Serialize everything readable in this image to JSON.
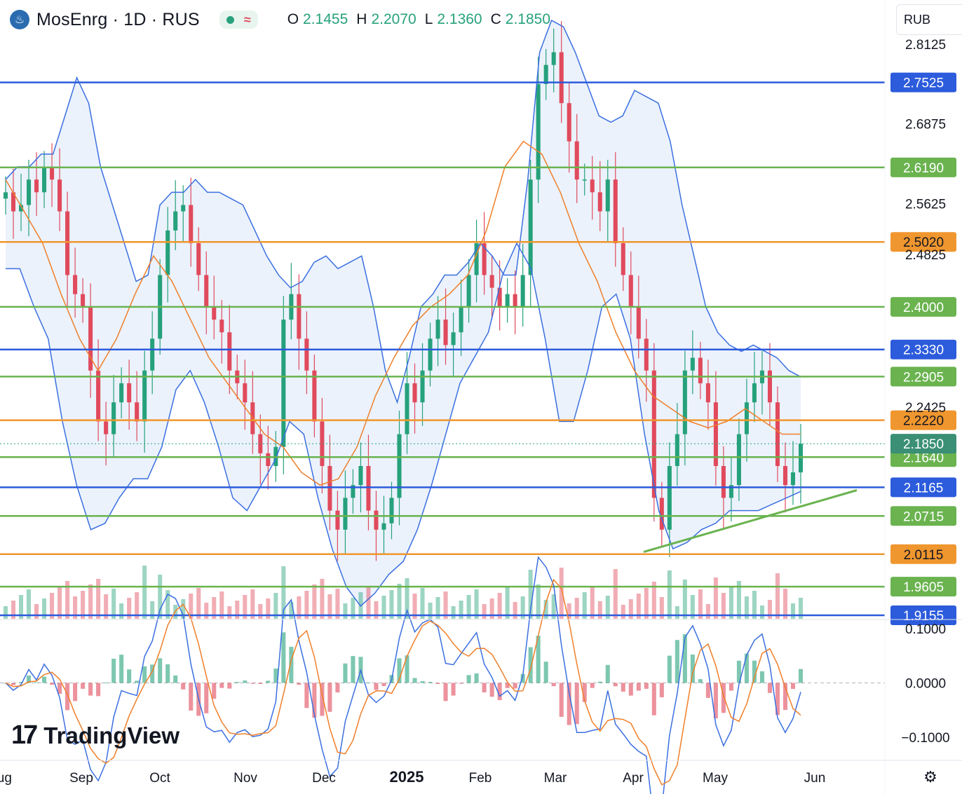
{
  "header": {
    "symbol_title": "MosEnrg · 1D · RUS",
    "logo_icon": "gazprom-flame-icon",
    "ohlc": [
      {
        "label": "O",
        "value": "2.1455"
      },
      {
        "label": "H",
        "value": "2.2070"
      },
      {
        "label": "L",
        "value": "2.1360"
      },
      {
        "label": "C",
        "value": "2.1850"
      }
    ]
  },
  "currency": {
    "label": "RUB"
  },
  "watermark": {
    "text": "TradingView",
    "mark": "17"
  },
  "colors": {
    "up": "#26a17b",
    "down": "#e04a5c",
    "bollinger": "#3b6fe0",
    "bollinger_fill": "#e7f0fb",
    "ma": "#ef7f2a",
    "blue_level": "#2c5bdc",
    "green_level": "#6ab34f",
    "orange_level": "#f0962e"
  },
  "chart_data": {
    "type": "candlestick",
    "price_axis": {
      "range": [
        1.91,
        2.86
      ],
      "tick_labels": [
        "2.8125",
        "2.6875",
        "2.5625",
        "2.4825",
        "2.2425"
      ]
    },
    "date_axis": {
      "labels": [
        "Aug",
        "Sep",
        "Oct",
        "Nov",
        "Dec",
        "2025",
        "Feb",
        "Mar",
        "Apr",
        "May",
        "Jun"
      ]
    },
    "last_price": {
      "value": "2.1850"
    },
    "levels": [
      {
        "value": "2.7525",
        "color": "blue"
      },
      {
        "value": "2.6190",
        "color": "green"
      },
      {
        "value": "2.5020",
        "color": "orange"
      },
      {
        "value": "2.4000",
        "color": "green"
      },
      {
        "value": "2.3330",
        "color": "blue"
      },
      {
        "value": "2.2905",
        "color": "green"
      },
      {
        "value": "2.2220",
        "color": "orange"
      },
      {
        "value": "2.1640",
        "color": "green"
      },
      {
        "value": "2.1165",
        "color": "blue"
      },
      {
        "value": "2.0715",
        "color": "green"
      },
      {
        "value": "2.0115",
        "color": "orange"
      },
      {
        "value": "1.9605",
        "color": "green"
      },
      {
        "value": "1.9155",
        "color": "blue"
      }
    ],
    "trendline": {
      "from": {
        "date": "Apr",
        "price": 2.015
      },
      "to": {
        "date": "Jun",
        "price": 2.112
      }
    },
    "close_series": [
      2.58,
      2.55,
      2.56,
      2.6,
      2.58,
      2.62,
      2.6,
      2.55,
      2.45,
      2.42,
      2.4,
      2.3,
      2.22,
      2.2,
      2.25,
      2.28,
      2.25,
      2.22,
      2.3,
      2.35,
      2.45,
      2.52,
      2.55,
      2.56,
      2.5,
      2.45,
      2.4,
      2.38,
      2.36,
      2.3,
      2.28,
      2.25,
      2.2,
      2.17,
      2.15,
      2.18,
      2.38,
      2.42,
      2.35,
      2.3,
      2.22,
      2.15,
      2.08,
      2.05,
      2.1,
      2.12,
      2.15,
      2.08,
      2.05,
      2.06,
      2.1,
      2.2,
      2.28,
      2.25,
      2.3,
      2.35,
      2.38,
      2.34,
      2.36,
      2.4,
      2.45,
      2.5,
      2.45,
      2.43,
      2.4,
      2.42,
      2.4,
      2.45,
      2.6,
      2.75,
      2.78,
      2.8,
      2.72,
      2.66,
      2.6,
      2.6,
      2.58,
      2.55,
      2.6,
      2.5,
      2.45,
      2.4,
      2.35,
      2.3,
      2.1,
      2.05,
      2.15,
      2.2,
      2.3,
      2.32,
      2.28,
      2.25,
      2.15,
      2.1,
      2.12,
      2.2,
      2.25,
      2.28,
      2.3,
      2.25,
      2.15,
      2.12,
      2.14,
      2.185
    ],
    "bollinger_upper": [
      2.6,
      2.62,
      2.62,
      2.64,
      2.64,
      2.7,
      2.76,
      2.72,
      2.62,
      2.56,
      2.5,
      2.44,
      2.45,
      2.56,
      2.58,
      2.58,
      2.6,
      2.58,
      2.58,
      2.57,
      2.56,
      2.52,
      2.48,
      2.45,
      2.43,
      2.44,
      2.47,
      2.48,
      2.46,
      2.47,
      2.48,
      2.4,
      2.3,
      2.25,
      2.32,
      2.4,
      2.42,
      2.45,
      2.45,
      2.47,
      2.5,
      2.48,
      2.45,
      2.45,
      2.6,
      2.8,
      2.85,
      2.84,
      2.8,
      2.75,
      2.7,
      2.69,
      2.7,
      2.74,
      2.73,
      2.72,
      2.66,
      2.56,
      2.48,
      2.4,
      2.36,
      2.34,
      2.33,
      2.34,
      2.33,
      2.32,
      2.3,
      2.29
    ],
    "bollinger_lower": [
      2.46,
      2.46,
      2.4,
      2.35,
      2.22,
      2.12,
      2.05,
      2.06,
      2.1,
      2.13,
      2.13,
      2.18,
      2.27,
      2.3,
      2.25,
      2.18,
      2.1,
      2.08,
      2.12,
      2.16,
      2.22,
      2.2,
      2.1,
      2.02,
      1.96,
      1.93,
      1.95,
      1.98,
      2.0,
      2.05,
      2.12,
      2.2,
      2.28,
      2.32,
      2.36,
      2.45,
      2.5,
      2.46,
      2.35,
      2.22,
      2.22,
      2.3,
      2.4,
      2.42,
      2.35,
      2.2,
      2.08,
      2.02,
      2.03,
      2.05,
      2.06,
      2.08,
      2.08,
      2.08,
      2.09,
      2.1,
      2.11
    ],
    "ma_series": [
      2.6,
      2.55,
      2.5,
      2.42,
      2.35,
      2.3,
      2.35,
      2.42,
      2.48,
      2.44,
      2.38,
      2.32,
      2.28,
      2.24,
      2.2,
      2.18,
      2.14,
      2.12,
      2.13,
      2.18,
      2.26,
      2.32,
      2.37,
      2.4,
      2.42,
      2.45,
      2.52,
      2.62,
      2.66,
      2.64,
      2.58,
      2.5,
      2.44,
      2.36,
      2.3,
      2.26,
      2.24,
      2.22,
      2.21,
      2.22,
      2.24,
      2.22,
      2.2,
      2.2
    ],
    "volume_panel": {
      "note": "volume bars colored by candle direction"
    },
    "macd": {
      "axis_labels": [
        "0.1000",
        "0.0000",
        "−0.1000"
      ],
      "range": [
        -0.12,
        0.12
      ]
    }
  }
}
